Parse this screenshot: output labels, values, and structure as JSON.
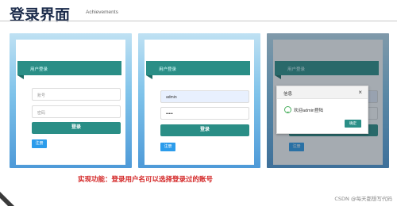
{
  "header": {
    "title": "登录界面",
    "subtitle": "Achievements"
  },
  "panels": [
    {
      "card_title": "用户登录",
      "username_placeholder": "账号",
      "password_placeholder": "密码",
      "login_label": "登录",
      "register_label": "注册"
    },
    {
      "card_title": "用户登录",
      "username_value": "admin",
      "password_value": "•••••",
      "login_label": "登录",
      "register_label": "注册"
    },
    {
      "card_title": "用户登录",
      "username_value": "admin",
      "login_label": "登录",
      "register_label": "注册",
      "dialog": {
        "title": "信息",
        "message": "欢迎admin登陆",
        "ok_label": "确定"
      }
    }
  ],
  "caption": "实现功能：登录用户名可以选择登录过的账号",
  "watermark": "CSDN @每天都想写代码",
  "colors": {
    "accent": "#2a8e86",
    "register": "#2c9ceb",
    "caption": "#d32424"
  }
}
